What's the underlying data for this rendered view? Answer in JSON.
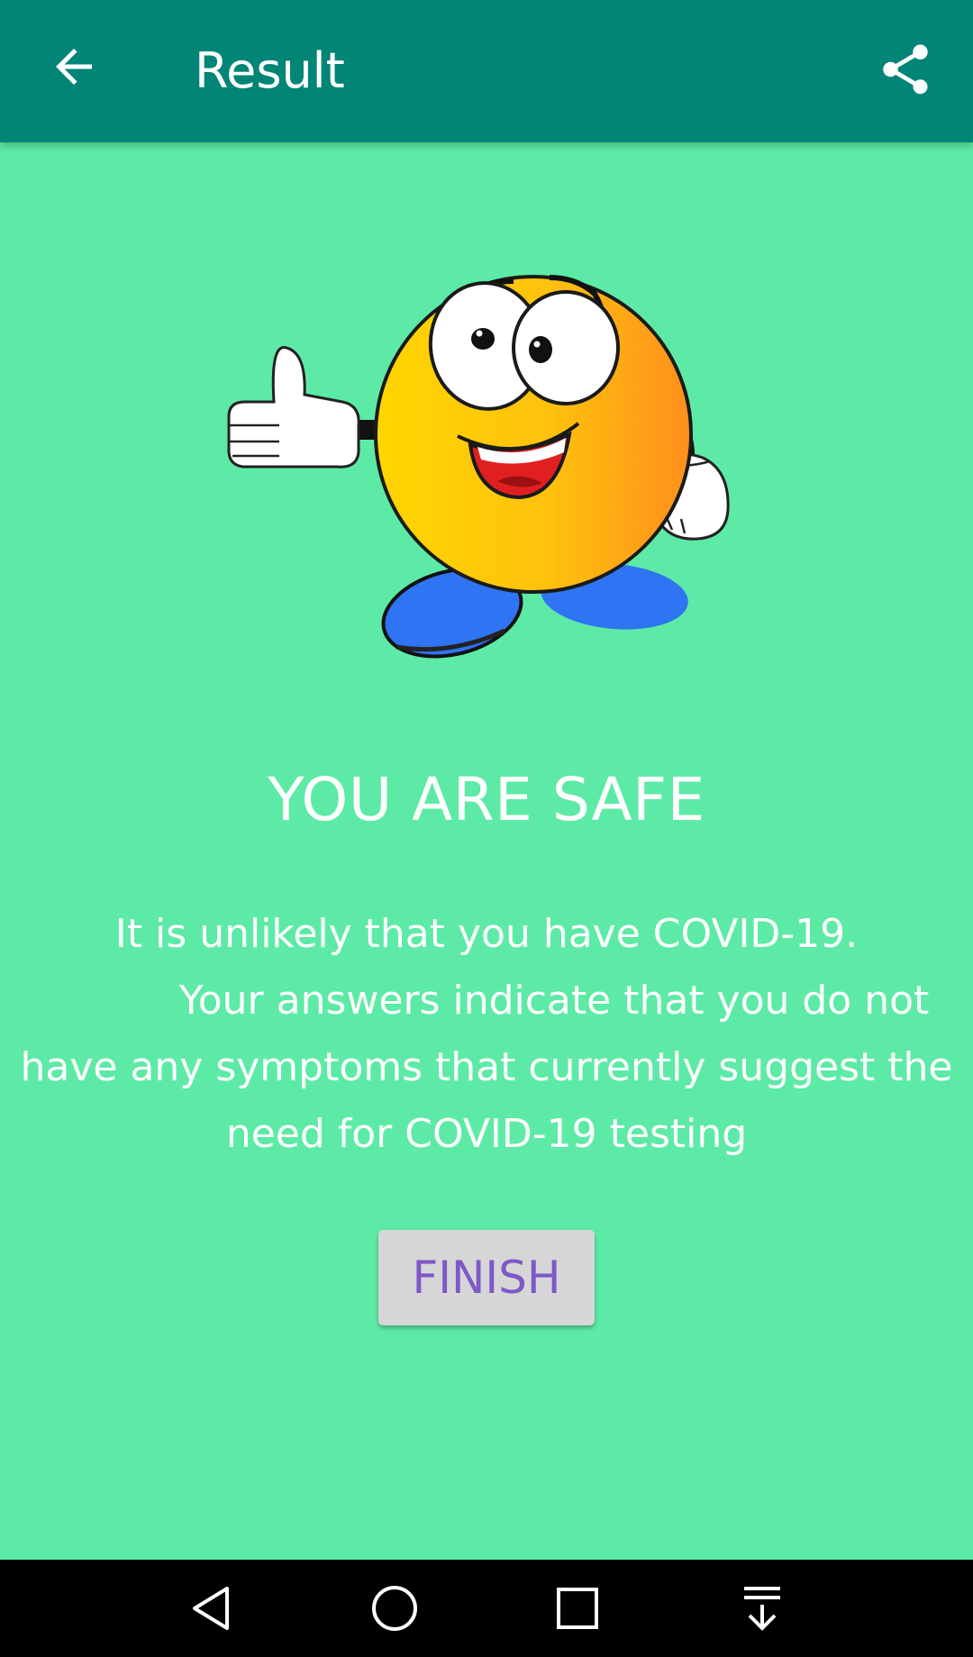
{
  "app_bar": {
    "title": "Result",
    "back_icon": "arrow-back-icon",
    "share_icon": "share-icon",
    "color": "#008577"
  },
  "illustration": {
    "description_icon": "thumbs-up-smiley-mascot"
  },
  "result": {
    "heading": "YOU ARE SAFE",
    "message_lines": [
      "It is unlikely that you have COVID-19.",
      "Your answers indicate that you do not",
      "have any symptoms that currently suggest the",
      "need for COVID-19 testing"
    ]
  },
  "actions": {
    "finish_label": "FINISH"
  },
  "system_nav": {
    "back_icon": "nav-back-icon",
    "home_icon": "nav-home-icon",
    "recents_icon": "nav-recents-icon",
    "notifications_icon": "nav-pull-down-icon"
  },
  "colors": {
    "background": "#5deaa6",
    "app_bar": "#008577",
    "button_text": "#7e58c8",
    "button_bg": "#d6d6d6"
  }
}
